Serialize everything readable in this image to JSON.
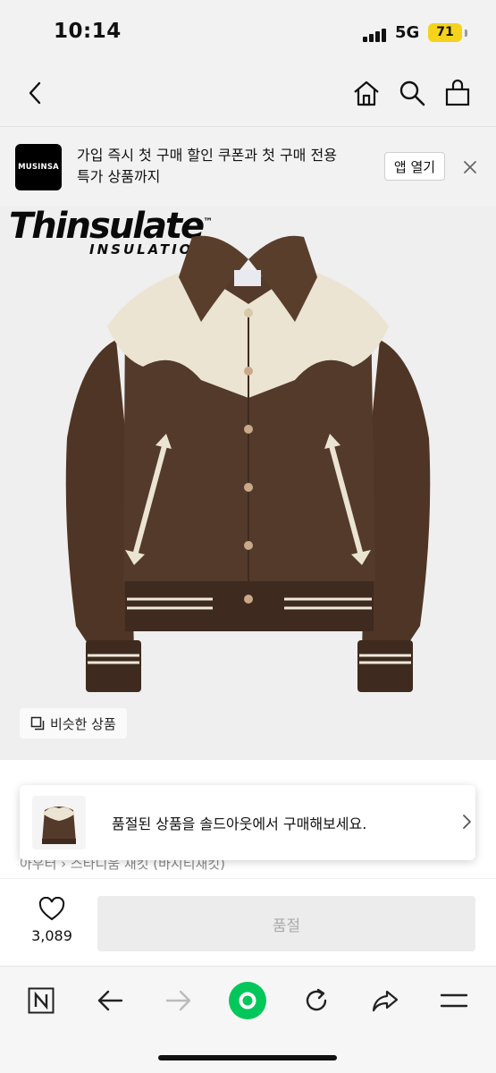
{
  "status_bar": {
    "time": "10:14",
    "network": "5G",
    "battery": "71"
  },
  "banner": {
    "logo_text": "MUSINSA",
    "promo_line1": "가입 즉시 첫 구매 할인 쿠폰과 첫 구매 전용",
    "promo_line2": "특가 상품까지",
    "open_app_label": "앱 열기"
  },
  "product": {
    "brand_overlay_1": "Thinsulate",
    "brand_overlay_tm": "™",
    "brand_overlay_2": "INSULATION",
    "similar_label": "비슷한 상품",
    "breadcrumb": "아우터 › 스타디움 재킷 (바시티재킷)"
  },
  "soldout_popup": {
    "message": "품절된 상품을 솔드아웃에서 구매해보세요."
  },
  "buy_bar": {
    "like_count": "3,089",
    "soldout_button_label": "품절"
  },
  "colors": {
    "accent_green": "#03c75a",
    "battery_yellow": "#f5d31a"
  },
  "icons": [
    "back-icon",
    "home-icon",
    "search-icon",
    "bag-icon",
    "close-icon",
    "similar-icon",
    "chevron-right-icon",
    "heart-icon",
    "naver-n-icon",
    "back-arrow-icon",
    "forward-arrow-icon",
    "green-dot-icon",
    "refresh-icon",
    "share-icon",
    "menu-icon"
  ]
}
